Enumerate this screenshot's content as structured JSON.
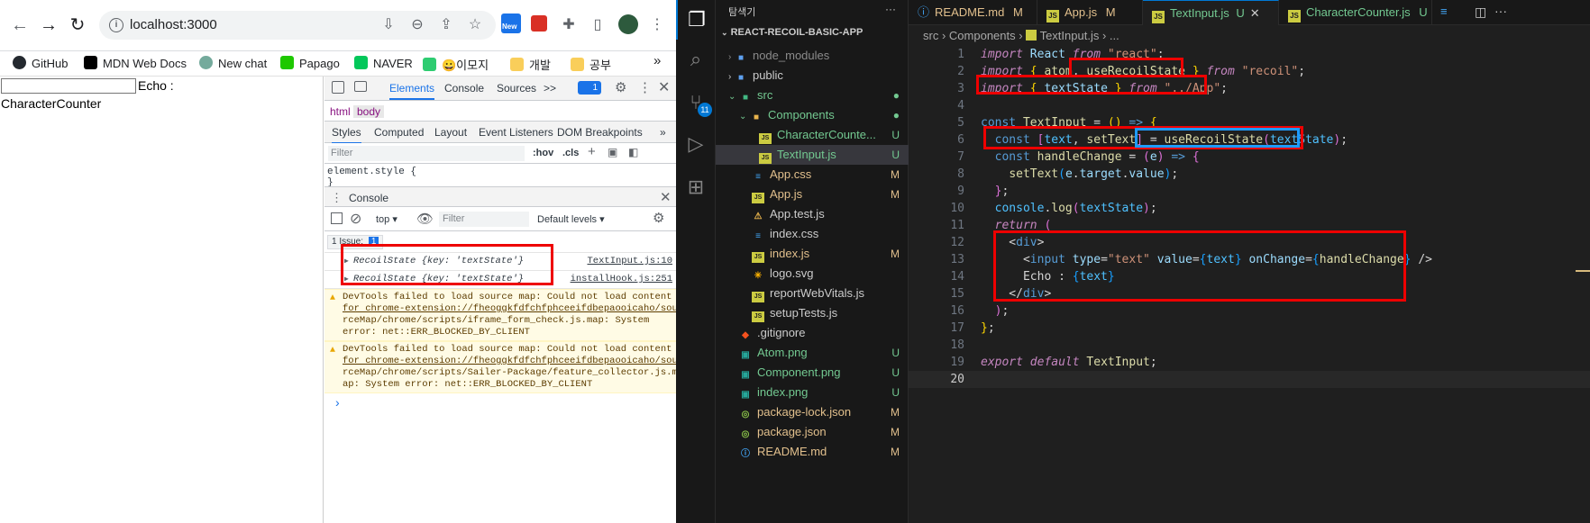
{
  "browser": {
    "url": "localhost:3000",
    "new_badge": "New",
    "bookmarks": [
      "GitHub",
      "MDN Web Docs",
      "New chat",
      "Papago",
      "NAVER",
      "😀이모지",
      "개발",
      "공부"
    ],
    "overflow": "»"
  },
  "page": {
    "input_value": "",
    "echo_label": "Echo :",
    "character_counter": "CharacterCounter"
  },
  "devtools": {
    "tabs": [
      "Elements",
      "Console",
      "Sources"
    ],
    "more": ">>",
    "issue_count": "1",
    "crumbs": [
      "html",
      "body"
    ],
    "subtabs": [
      "Styles",
      "Computed",
      "Layout",
      "Event Listeners",
      "DOM Breakpoints"
    ],
    "filter_placeholder": "Filter",
    "hov": ":hov",
    "cls": ".cls",
    "element_style": "element.style {",
    "element_style_close": "}",
    "drawer_title": "Console",
    "context": "top",
    "console_filter": "Filter",
    "levels": "Default levels",
    "issue_label": "1 Issue:",
    "issue_badge": "1",
    "logs": [
      {
        "text": "RecoilState {key: 'textState'}",
        "source": "TextInput.js:10"
      },
      {
        "text": "RecoilState {key: 'textState'}",
        "source": "installHook.js:251"
      }
    ],
    "warnings": [
      {
        "line1": "DevTools failed to load source map: Could not load content",
        "line2": "for chrome-extension://fheoggkfdfchfphceeifdbepaooicaho/sou",
        "line3": "rceMap/chrome/scripts/iframe_form_check.js.map: System",
        "line4": "error: net::ERR_BLOCKED_BY_CLIENT"
      },
      {
        "line1": "DevTools failed to load source map: Could not load content",
        "line2": "for chrome-extension://fheoggkfdfchfphceeifdbepaooicaho/sou",
        "line3": "rceMap/chrome/scripts/Sailer-Package/feature_collector.js.m",
        "line4": "ap: System error: net::ERR_BLOCKED_BY_CLIENT"
      }
    ],
    "prompt": "›"
  },
  "vscode": {
    "explorer_title": "탐색기",
    "explorer_more": "···",
    "project": "REACT-RECOIL-BASIC-APP",
    "source_control_badge": "11",
    "tree": [
      {
        "name": "node_modules",
        "status": ""
      },
      {
        "name": "public",
        "status": ""
      },
      {
        "name": "src",
        "status": ""
      },
      {
        "name": "Components",
        "status": ""
      },
      {
        "name": "CharacterCounte...",
        "status": "U"
      },
      {
        "name": "TextInput.js",
        "status": "U"
      },
      {
        "name": "App.css",
        "status": "M"
      },
      {
        "name": "App.js",
        "status": "M"
      },
      {
        "name": "App.test.js",
        "status": ""
      },
      {
        "name": "index.css",
        "status": ""
      },
      {
        "name": "index.js",
        "status": "M"
      },
      {
        "name": "logo.svg",
        "status": ""
      },
      {
        "name": "reportWebVitals.js",
        "status": ""
      },
      {
        "name": "setupTests.js",
        "status": ""
      },
      {
        "name": ".gitignore",
        "status": ""
      },
      {
        "name": "Atom.png",
        "status": "U"
      },
      {
        "name": "Component.png",
        "status": "U"
      },
      {
        "name": "index.png",
        "status": "U"
      },
      {
        "name": "package-lock.json",
        "status": "M"
      },
      {
        "name": "package.json",
        "status": "M"
      },
      {
        "name": "README.md",
        "status": "M"
      }
    ],
    "tabs": [
      {
        "name": "README.md",
        "status": "M"
      },
      {
        "name": "App.js",
        "status": "M"
      },
      {
        "name": "TextInput.js",
        "status": "U"
      },
      {
        "name": "CharacterCounter.js",
        "status": "U"
      }
    ],
    "breadcrumb": [
      "src",
      "Components",
      "TextInput.js",
      "..."
    ],
    "line_numbers": [
      "1",
      "2",
      "3",
      "4",
      "5",
      "6",
      "7",
      "8",
      "9",
      "10",
      "11",
      "12",
      "13",
      "14",
      "15",
      "16",
      "17",
      "18",
      "19",
      "20"
    ]
  },
  "colors": {
    "highlight_red": "#e00000",
    "highlight_blue": "#1e9bff"
  }
}
